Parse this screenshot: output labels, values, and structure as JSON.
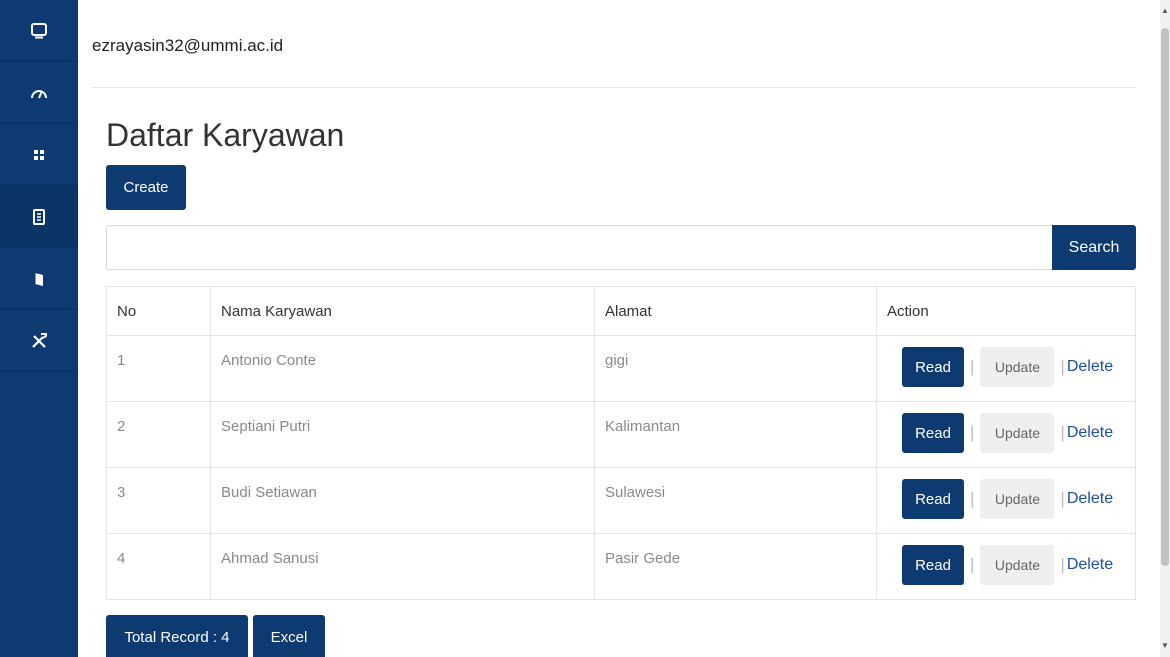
{
  "sidebar": {
    "items": [
      {
        "icon": "monitor-icon"
      },
      {
        "icon": "speedometer-icon"
      },
      {
        "icon": "grid-icon"
      },
      {
        "icon": "document-icon"
      },
      {
        "icon": "book-icon"
      },
      {
        "icon": "tools-icon"
      }
    ]
  },
  "header": {
    "user_email": "ezrayasin32@ummi.ac.id"
  },
  "page": {
    "title": "Daftar Karyawan",
    "create_label": "Create"
  },
  "search": {
    "placeholder": "",
    "value": "",
    "button_label": "Search"
  },
  "table": {
    "headers": [
      "No",
      "Nama Karyawan",
      "Alamat",
      "Action"
    ],
    "rows": [
      {
        "no": "1",
        "name": "Antonio Conte",
        "address": "gigi"
      },
      {
        "no": "2",
        "name": "Septiani Putri",
        "address": "Kalimantan"
      },
      {
        "no": "3",
        "name": "Budi Setiawan",
        "address": "Sulawesi"
      },
      {
        "no": "4",
        "name": "Ahmad Sanusi",
        "address": "Pasir Gede"
      }
    ],
    "action_labels": {
      "read": "Read",
      "separator": "|",
      "update": "Update",
      "delete": "Delete"
    }
  },
  "footer": {
    "total_label": "Total Record : 4",
    "excel_label": "Excel"
  },
  "colors": {
    "primary": "#0e3a72",
    "link": "#1f4fa0"
  }
}
